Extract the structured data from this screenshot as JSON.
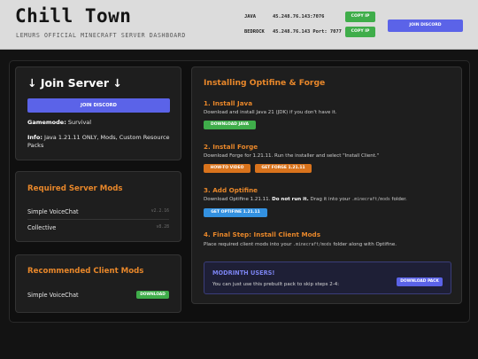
{
  "header": {
    "title": "Chill Town",
    "subtitle": "LEMURS OFFICIAL MINECRAFT SERVER DASHBOARD",
    "java_label": "JAVA",
    "java_ip": "45.248.76.143:7076",
    "bedrock_label": "BEDROCK",
    "bedrock_ip": "45.248.76.143 Port: 7077",
    "copy_ip_label": "COPY IP",
    "discord_label": "JOIN DISCORD"
  },
  "join": {
    "heading": "↓ Join Server ↓",
    "discord_label": "JOIN DISCORD",
    "gamemode_label": "Gamemode:",
    "gamemode_value": "Survival",
    "info_label": "Info:",
    "info_value": "Java 1.21.11 ONLY, Mods, Custom Resource Packs"
  },
  "required_mods": {
    "title": "Required Server Mods",
    "items": [
      {
        "name": "Simple VoiceChat",
        "version": "v2.2.16"
      },
      {
        "name": "Collective",
        "version": "v8.28"
      }
    ]
  },
  "recommended_mods": {
    "title": "Recommended Client Mods",
    "items": [
      {
        "name": "Simple VoiceChat",
        "action": "DOWNLOAD"
      }
    ]
  },
  "install": {
    "title": "Installing Optifine & Forge",
    "steps": [
      {
        "title": "1. Install Java",
        "desc": "Download and install Java 21 (JDK) if you don't have it.",
        "buttons": [
          "DOWNLOAD JAVA"
        ]
      },
      {
        "title": "2. Install Forge",
        "desc": "Download Forge for 1.21.11. Run the installer and select \"Install Client.\"",
        "buttons": [
          "HOW-TO VIDEO",
          "GET FORGE 1.21.11"
        ]
      },
      {
        "title": "3. Add Optifine",
        "desc_a": "Download Optifine 1.21.11.",
        "desc_bold": "Do not run it.",
        "desc_b": "Drag it into your",
        "desc_code": ".minecraft/mods",
        "desc_c": "folder.",
        "buttons": [
          "GET OPTIFINE 1.21.11"
        ]
      },
      {
        "title": "4. Final Step: Install Client Mods",
        "desc_a": "Place required client mods into your",
        "desc_code": ".minecraft/mods",
        "desc_b": "folder along with Optifine."
      }
    ],
    "modrinth": {
      "title": "MODRINTH USERS!",
      "text": "You can just use this prebuilt pack to skip steps 2-4:",
      "button": "DOWNLOAD PACK"
    }
  },
  "colors": {
    "accent_orange": "#e8872a",
    "discord_blue": "#5b63e8",
    "green": "#3fad4a",
    "orange_button": "#d9731c",
    "blue_button": "#3391e0"
  }
}
